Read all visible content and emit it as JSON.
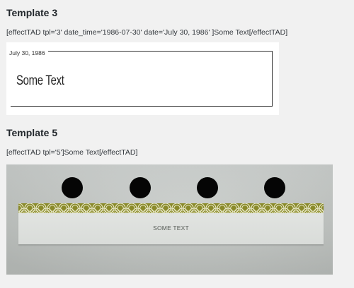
{
  "template3": {
    "heading": "Template 3",
    "shortcode": "[effectTAD tpl='3' date_time='1986-07-30' date='July 30, 1986' ]Some Text[/effectTAD]",
    "preview": {
      "date": "July 30, 1986",
      "text": "Some Text"
    }
  },
  "template5": {
    "heading": "Template 5",
    "shortcode": "[effectTAD tpl='5']Some Text[/effectTAD]",
    "preview": {
      "text": "SOME TEXT",
      "band_color": "#8a8a2a"
    }
  },
  "colors": {
    "page_bg": "#f1f1f1",
    "heading": "#23282d",
    "olive_pattern": "#8a8a2a"
  }
}
